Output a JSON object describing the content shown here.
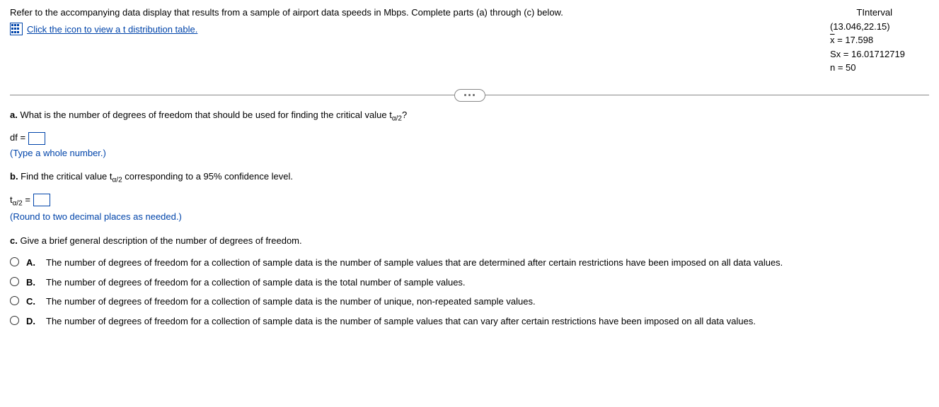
{
  "intro": "Refer to the accompanying data display that results from a sample of airport data speeds in Mbps. Complete parts (a) through (c) below.",
  "link": "Click the icon to view a t distribution table.",
  "panel": {
    "title": "TInterval",
    "interval": "(13.046,22.15)",
    "xbar": "= 17.598",
    "sx": "Sx = 16.01712719",
    "n": "n = 50"
  },
  "a": {
    "label": "a.",
    "text": " What is the number of degrees of freedom that should be used for finding the critical value t",
    "sub": "α/2",
    "tail": "?",
    "eq": "df =",
    "hint": "(Type a whole number.)"
  },
  "b": {
    "label": "b.",
    "text": " Find the critical value t",
    "sub": "α/2",
    "tail": " corresponding to a 95% confidence level.",
    "eq_pre": "t",
    "eq_sub": "α/2",
    "eq_post": " =",
    "hint": "(Round to two decimal places as needed.)"
  },
  "c": {
    "label": "c.",
    "text": " Give a brief general description of the number of degrees of freedom.",
    "options": [
      {
        "letter": "A.",
        "text": "The number of degrees of freedom for a collection of sample data is the number of sample values that are determined after certain restrictions have been imposed on all data values."
      },
      {
        "letter": "B.",
        "text": "The number of degrees of freedom for a collection of sample data is the total number of sample values."
      },
      {
        "letter": "C.",
        "text": "The number of degrees of freedom for a collection of sample data is the number of unique, non-repeated sample values."
      },
      {
        "letter": "D.",
        "text": "The number of degrees of freedom for a collection of sample data is the number of sample values that can vary after certain restrictions have been imposed on all data values."
      }
    ]
  }
}
